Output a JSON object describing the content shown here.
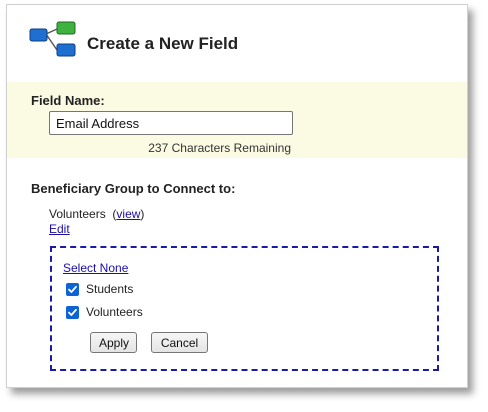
{
  "header": {
    "title": "Create a New Field",
    "icon": "hierarchy-icon",
    "icon_colors": {
      "blue": "#1f6fd1",
      "green": "#3fb13f"
    }
  },
  "field_name": {
    "label": "Field Name:",
    "value": "Email Address",
    "chars_remaining": "237 Characters Remaining"
  },
  "beneficiary_group": {
    "label": "Beneficiary Group to Connect to:",
    "current_value": "Volunteers",
    "view_link": "view",
    "edit_link": "Edit",
    "select_none_link": "Select None",
    "options": [
      {
        "label": "Students",
        "checked": true
      },
      {
        "label": "Volunteers",
        "checked": true
      }
    ],
    "apply_label": "Apply",
    "cancel_label": "Cancel"
  },
  "colors": {
    "name_section_bg": "#fbfbe3",
    "dashed_border": "#1a1aa8",
    "link": "#1a0dab",
    "checkbox": "#0b63d6"
  }
}
